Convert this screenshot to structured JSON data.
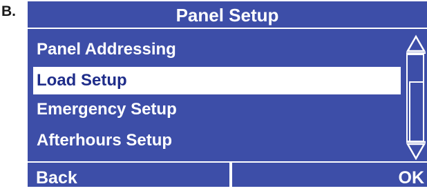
{
  "figure": {
    "label": "B."
  },
  "screen": {
    "title": "Panel Setup",
    "menu_items": [
      {
        "label": "Panel Addressing",
        "selected": false
      },
      {
        "label": "Load Setup",
        "selected": true
      },
      {
        "label": "Emergency Setup",
        "selected": false
      },
      {
        "label": "Afterhours Setup",
        "selected": false
      }
    ],
    "scrollbar": {
      "up_icon": "triangle-up-outline",
      "down_icon": "triangle-down-outline"
    },
    "softkeys": {
      "left_label": "Back",
      "right_label": "OK"
    }
  },
  "colors": {
    "screen_background": "#3d4ea8",
    "selected_text": "#1f2d8a",
    "foreground": "#ffffff"
  }
}
